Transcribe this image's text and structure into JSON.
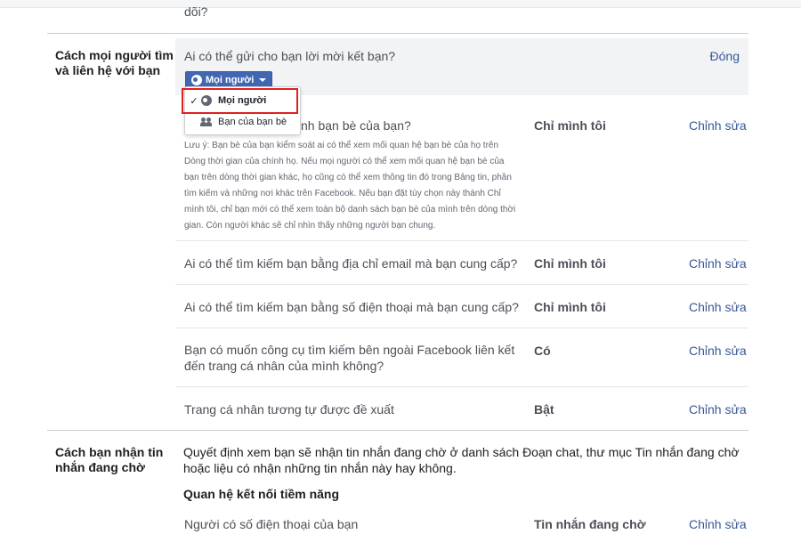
{
  "previous_section": {
    "tail_text": "dõi?"
  },
  "find_contact": {
    "title": "Cách mọi người tìm và liên hệ với bạn",
    "edit_panel": {
      "question": "Ai có thể gửi cho bạn lời mời kết bạn?",
      "close_label": "Đóng",
      "audience_button_label": "Mọi người",
      "dropdown": {
        "options": [
          {
            "label": "Mọi người",
            "selected": true,
            "icon": "globe-icon"
          },
          {
            "label": "Bạn của bạn bè",
            "selected": false,
            "icon": "friends-icon"
          }
        ],
        "check_glyph": "✓"
      }
    },
    "rows": [
      {
        "question": "nh bạn bè của bạn?",
        "value": "Chỉ mình tôi",
        "edit_label": "Chỉnh sửa",
        "note": "Lưu ý: Bạn bè của bạn kiểm soát ai có thể xem mối quan hệ bạn bè của họ trên Dòng thời gian của chính họ. Nếu mọi người có thể xem mối quan hệ bạn bè của bạn trên dòng thời gian khác, họ cũng có thể xem thông tin đó trong Bảng tin, phần tìm kiếm và những nơi khác trên Facebook. Nếu bạn đặt tùy chọn này thành Chỉ mình tôi, chỉ bạn mới có thể xem toàn bộ danh sách bạn bè của mình trên dòng thời gian. Còn người khác sẽ chỉ nhìn thấy những người bạn chung."
      },
      {
        "question": "Ai có thể tìm kiếm bạn bằng địa chỉ email mà bạn cung cấp?",
        "value": "Chỉ mình tôi",
        "edit_label": "Chỉnh sửa"
      },
      {
        "question": "Ai có thể tìm kiếm bạn bằng số điện thoại mà bạn cung cấp?",
        "value": "Chỉ mình tôi",
        "edit_label": "Chỉnh sửa"
      },
      {
        "question": "Bạn có muốn công cụ tìm kiếm bên ngoài Facebook liên kết đến trang cá nhân của mình không?",
        "value": "Có",
        "edit_label": "Chỉnh sửa"
      },
      {
        "question": "Trang cá nhân tương tự được đề xuất",
        "value": "Bật",
        "edit_label": "Chỉnh sửa"
      }
    ]
  },
  "message_requests": {
    "title": "Cách bạn nhận tin nhắn đang chờ",
    "description": "Quyết định xem bạn sẽ nhận tin nhắn đang chờ ở danh sách Đoạn chat, thư mục Tin nhắn đang chờ hoặc liệu có nhận những tin nhắn này hay không.",
    "subheading": "Quan hệ kết nối tiềm năng",
    "rows": [
      {
        "question": "Người có số điện thoại của bạn",
        "value": "Tin nhắn đang chờ",
        "edit_label": "Chỉnh sửa"
      }
    ]
  },
  "colors": {
    "link": "#385898",
    "button": "#4267b2",
    "highlight": "#e02020",
    "panel": "#f2f3f5"
  }
}
